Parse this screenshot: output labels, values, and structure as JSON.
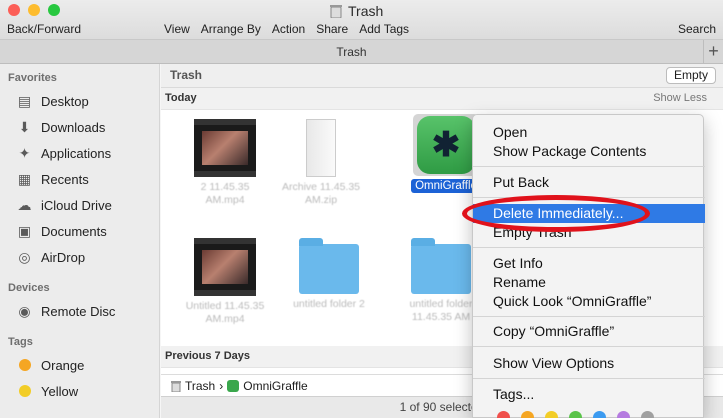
{
  "window": {
    "title": "Trash",
    "tab_title": "Trash",
    "tab_add": "+"
  },
  "toolbar": {
    "back_forward": "Back/Forward",
    "menu": [
      "View",
      "Arrange By",
      "Action",
      "Share",
      "Add Tags"
    ],
    "search": "Search"
  },
  "sidebar": {
    "favorites_heading": "Favorites",
    "favorites": [
      {
        "label": "Desktop",
        "icon": "desktop-icon"
      },
      {
        "label": "Downloads",
        "icon": "downloads-icon"
      },
      {
        "label": "Applications",
        "icon": "applications-icon"
      },
      {
        "label": "Recents",
        "icon": "recents-icon"
      },
      {
        "label": "iCloud Drive",
        "icon": "cloud-icon"
      },
      {
        "label": "Documents",
        "icon": "documents-icon"
      },
      {
        "label": "AirDrop",
        "icon": "airdrop-icon"
      }
    ],
    "devices_heading": "Devices",
    "devices": [
      {
        "label": "Remote Disc",
        "icon": "disc-icon"
      }
    ],
    "tags_heading": "Tags",
    "tags": [
      {
        "label": "Orange",
        "color": "#f5a623"
      },
      {
        "label": "Yellow",
        "color": "#f2cd27"
      }
    ]
  },
  "main": {
    "path_title": "Trash",
    "empty_button": "Empty",
    "today_section": "Today",
    "show_less": "Show Less",
    "previous_section": "Previous 7 Days",
    "files": [
      {
        "name": "2 11.45.35 AM.mp4",
        "kind": "video"
      },
      {
        "name": "Archive 11.45.35 AM.zip",
        "kind": "zip"
      },
      {
        "name": "OmniGraffle",
        "kind": "app"
      },
      {
        "name": "Untitled 11.45.35 AM.mp4",
        "kind": "video"
      },
      {
        "name": "untitled folder 2",
        "kind": "folder"
      },
      {
        "name": "untitled folder 11.45.35 AM",
        "kind": "folder"
      }
    ],
    "path_bar": {
      "root": "Trash",
      "separator": "›",
      "item": "OmniGraffle"
    },
    "status": "1 of 90 selected"
  },
  "context_menu": {
    "items": [
      "Open",
      "Show Package Contents",
      "Put Back",
      "Delete Immediately...",
      "Empty Trash",
      "Get Info",
      "Rename",
      "Quick Look “OmniGraffle”",
      "Copy “OmniGraffle”",
      "Show View Options",
      "Tags..."
    ],
    "highlighted": "Delete Immediately...",
    "tag_colors": [
      "#f0504c",
      "#f5a623",
      "#f2cd27",
      "#5ac34a",
      "#3c9bf0",
      "#b57be0",
      "#a0a0a0"
    ]
  },
  "colors": {
    "accent": "#2f7ae5",
    "annotation": "#e0121b"
  }
}
